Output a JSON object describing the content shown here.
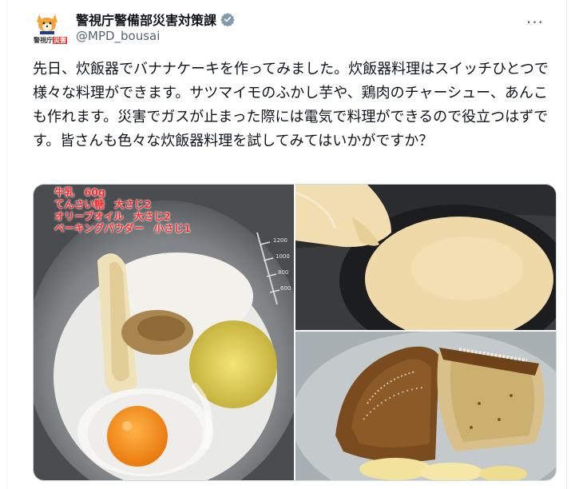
{
  "account": {
    "display_name": "警視庁警備部災害対策課",
    "handle": "@MPD_bousai",
    "avatar_text": "警視庁",
    "avatar_badge": "災害",
    "verified_icon": "verified-badge-icon",
    "more_icon": "more-options-icon",
    "more_glyph": "···"
  },
  "tweet": {
    "text": "先日、炊飯器でバナナケーキを作ってみました。炊飯器料理はスイッチひとつで様々な料理ができます。サツマイモのふかし芋や、鶏肉のチャーシュー、あんこも作れます。災害でガスが止まった際には電気で料理ができるので役立つはずです。皆さんも色々な炊飯器料理を試してみてはいかがですか？"
  },
  "media": {
    "photo1_overlay": [
      "牛乳　60g",
      "てんさい糖　大さじ2",
      "オリーブオイル　大さじ2",
      "ベーキングパウダー　小さじ1"
    ],
    "bowl_scale": [
      "1200",
      "1000",
      "800",
      "600"
    ]
  },
  "colors": {
    "accent": "#1d9bf0",
    "text": "#0f1419",
    "secondary": "#536471",
    "overlay_text": "#ff2b2b"
  }
}
